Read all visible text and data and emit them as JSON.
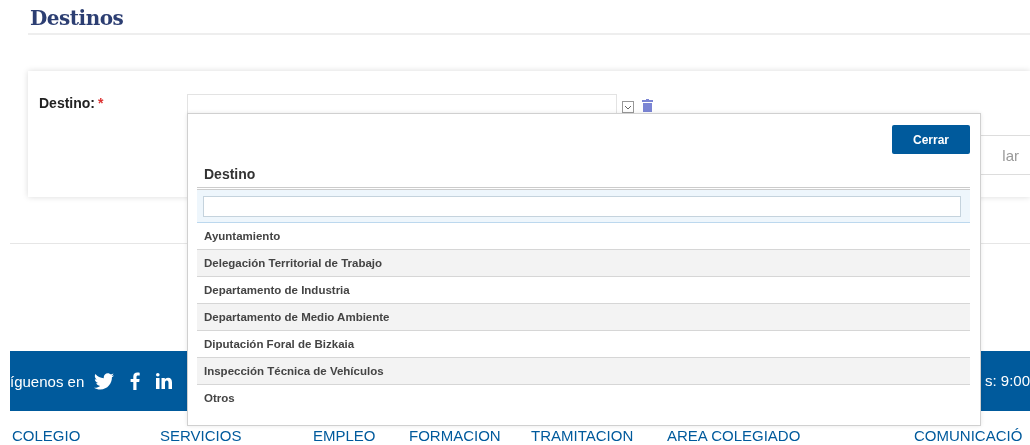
{
  "page": {
    "title": "Destinos"
  },
  "form": {
    "field_label": "Destino:",
    "required_mark": "*",
    "partial_button": "lar"
  },
  "footer": {
    "follow_text": "íguenos en",
    "hours_text": "s: 9:00"
  },
  "nav": [
    "COLEGIO",
    "SERVICIOS",
    "EMPLEO",
    "FORMACION",
    "TRAMITACION",
    "AREA COLEGIADO",
    "COMUNICACIÓ"
  ],
  "popup": {
    "close_button": "Cerrar",
    "column_header": "Destino",
    "options": [
      {
        "label": "Ayuntamiento"
      },
      {
        "label": "Delegación Territorial de Trabajo"
      },
      {
        "label": "Departamento de Industria"
      },
      {
        "label": "Departamento de Medio Ambiente"
      },
      {
        "label": "Diputación Foral de Bizkaia"
      },
      {
        "label": "Inspección Técnica de Vehículos"
      },
      {
        "label": "Otros"
      }
    ]
  }
}
